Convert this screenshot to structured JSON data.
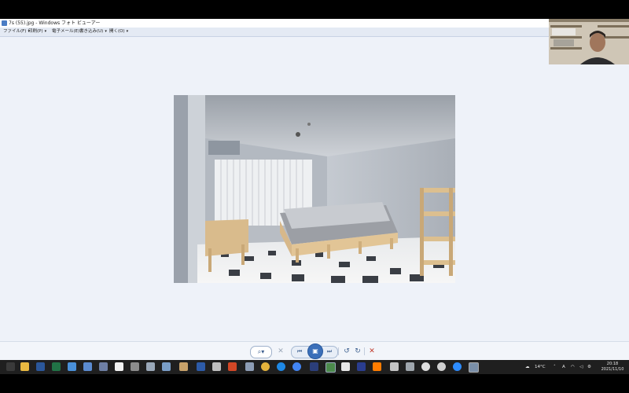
{
  "window": {
    "title": "7s (55).jpg - Windows フォト ビューアー"
  },
  "menu": [
    {
      "label": "ファイル(F)"
    },
    {
      "label": "印刷(P)"
    },
    {
      "label": "電子メール(E)"
    },
    {
      "label": "書き込み(U)"
    },
    {
      "label": "開く(O)"
    }
  ],
  "controls": {
    "zoom": "zoom-icon",
    "delete_disabled": "x-icon",
    "prev": "previous-icon",
    "slideshow": "slideshow-icon",
    "next": "next-icon",
    "rotate_left": "rotate-ccw-icon",
    "rotate_right": "rotate-cw-icon",
    "delete": "delete-icon"
  },
  "taskbar": {
    "weather": "14°C",
    "ime": "A",
    "time": "20:18",
    "date": "2021/11/10"
  },
  "colors": {
    "viewer_bg": "#eef2f9",
    "accent": "#3b6fb9",
    "delete": "#c0392b",
    "taskbar": "#1f1f1f"
  }
}
